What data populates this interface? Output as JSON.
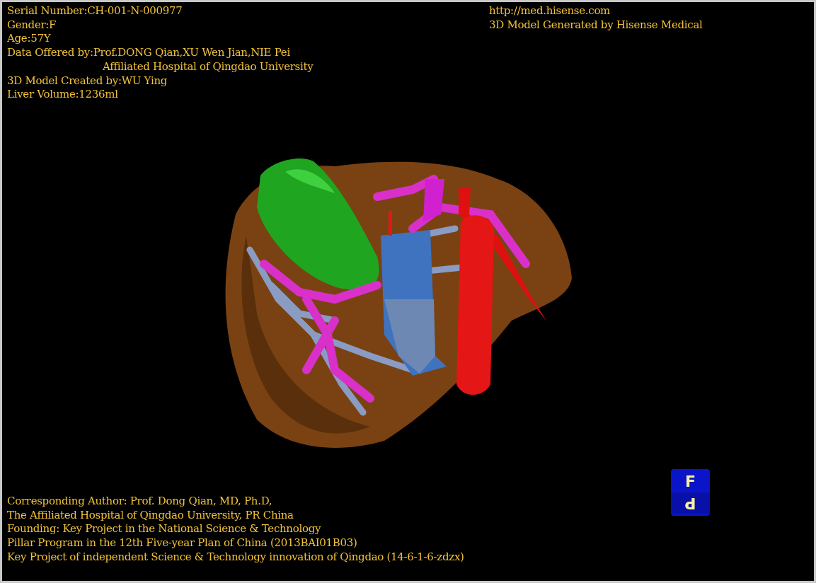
{
  "header_info": [
    {
      "kind": "line",
      "text": "Serial Number:CH-001-N-000977"
    },
    {
      "kind": "line",
      "text": "Gender:F"
    },
    {
      "kind": "line",
      "text": "Age:57Y"
    },
    {
      "kind": "line",
      "text": "Data Offered by:Prof.DONG Qian,XU Wen Jian,NIE Pei"
    },
    {
      "kind": "continuation",
      "text": "Affiliated Hospital of Qingdao University"
    },
    {
      "kind": "line",
      "text": "3D Model Created by:WU Ying"
    },
    {
      "kind": "line",
      "text": "Liver Volume:1236ml"
    }
  ],
  "branding": [
    "http://med.hisense.com",
    "3D Model Generated by Hisense Medical"
  ],
  "credits": [
    "Corresponding Author: Prof. Dong Qian, MD, Ph.D,",
    "The Affiliated Hospital of Qingdao University, PR China",
    "Founding: Key Project in the National Science & Technology",
    "Pillar Program in the 12th Five-year Plan of China (2013BAI01B03)",
    "Key Project of independent Science & Technology innovation of Qingdao (14-6-1-6-zdzx)"
  ],
  "orientation_cube": {
    "front": "F",
    "bottom": "P"
  }
}
